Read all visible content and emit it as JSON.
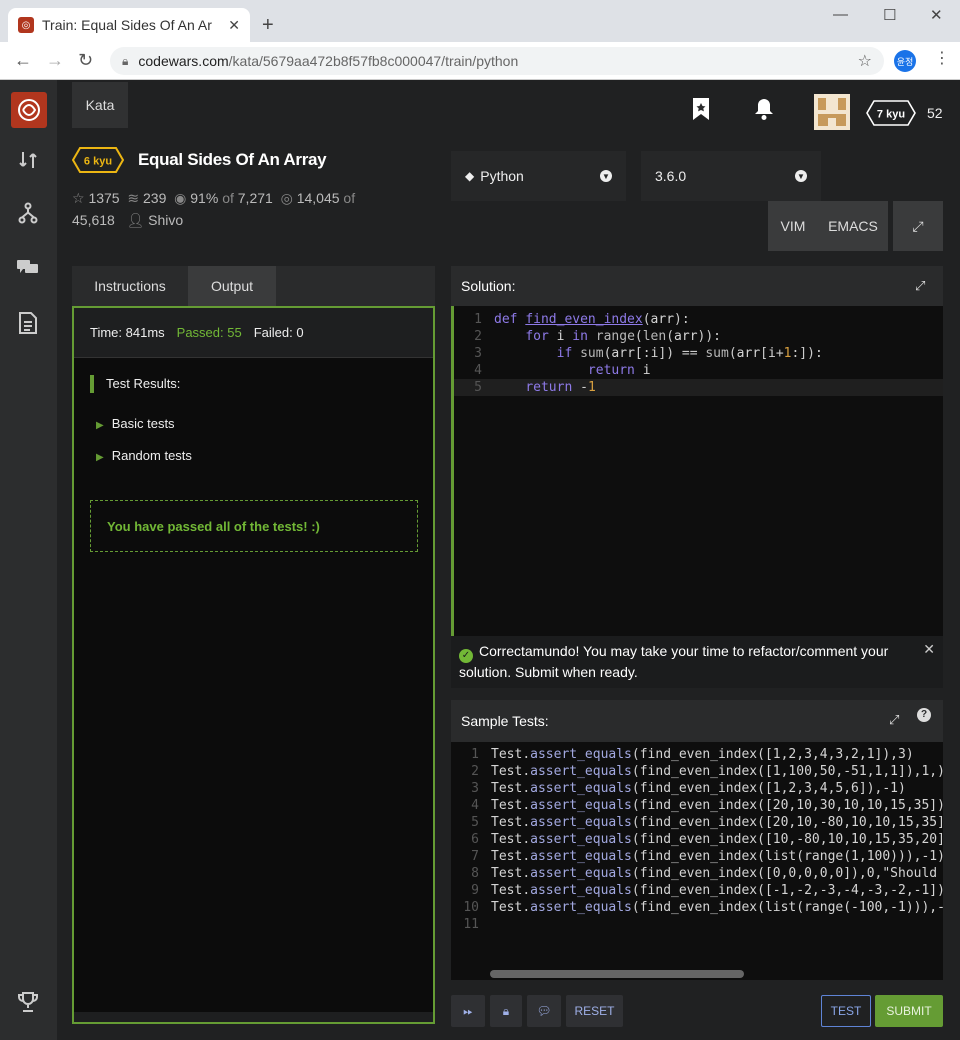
{
  "browser": {
    "tab_title": "Train: Equal Sides Of An Ar",
    "close": "✕",
    "new_tab": "+",
    "url_domain": "codewars.com",
    "url_path": "/kata/5679aa472b8f57fb8c000047/train/python",
    "profile": "윤정"
  },
  "nav": {
    "kata": "Kata",
    "rank": "7 kyu",
    "honor": "52"
  },
  "kata": {
    "kyu": "6 kyu",
    "title": "Equal Sides Of An Array",
    "stars": "1375",
    "collections": "239",
    "satisfaction": "91%",
    "of_label": "of",
    "votes": "7,271",
    "completed": "14,045",
    "of_label2": "of",
    "attempts": "45,618",
    "author": "Shivo"
  },
  "controls": {
    "language": "Python",
    "version": "3.6.0",
    "vim": "VIM",
    "emacs": "EMACS"
  },
  "left_tabs": {
    "instructions": "Instructions",
    "output": "Output"
  },
  "output": {
    "time": "Time: 841ms",
    "passed": "Passed: 55",
    "failed": "Failed: 0",
    "results_title": "Test Results:",
    "groups": [
      "Basic tests",
      "Random tests"
    ],
    "message": "You have passed all of the tests! :)"
  },
  "solution": {
    "title": "Solution:"
  },
  "notice": {
    "text": "Correctamundo! You may take your time to refactor/comment your solution. Submit when ready."
  },
  "sample_tests": {
    "title": "Sample Tests:",
    "lines": [
      "([1,2,3,4,3,2,1]),3)",
      "([1,100,50,-51,1,1]),1,)",
      "([1,2,3,4,5,6]),-1)",
      "([20,10,30,10,10,15,35]),",
      "([20,10,-80,10,10,15,35]",
      "([10,-80,10,10,15,35,20]",
      "(list(range(1,100))),-1)",
      "([0,0,0,0,0]),0,\"Should p",
      "([-1,-2,-3,-4,-3,-2,-1]),",
      "(list(range(-100,-1))),-1"
    ]
  },
  "buttons": {
    "reset": "RESET",
    "test": "TEST",
    "submit": "SUBMIT"
  },
  "colors": {
    "accent_green": "#659c34",
    "brand_red": "#b1361e",
    "link_blue": "#5f84d6"
  }
}
